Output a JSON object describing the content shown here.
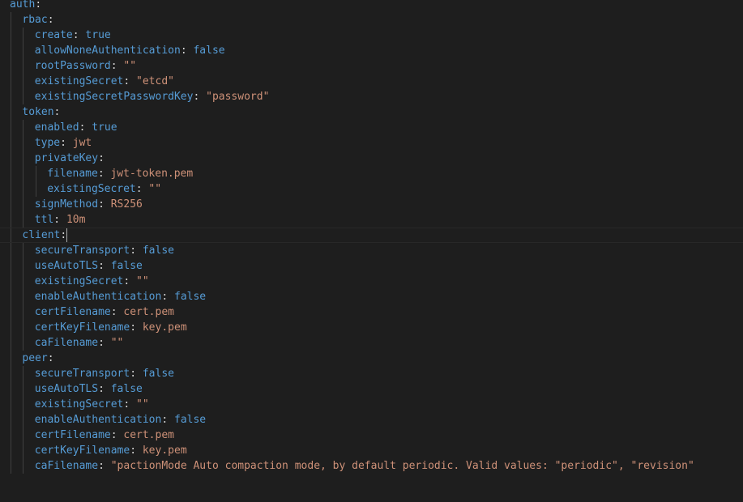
{
  "editor": {
    "language": "yaml",
    "theme": {
      "background": "#1e1e1e",
      "key_color": "#569cd6",
      "string_color": "#ce9178",
      "punctuation_color": "#d4d4d4",
      "indent_guide_color": "#404040",
      "current_line_border": "#282828"
    },
    "cursor": {
      "line_index": 15,
      "after": "client:"
    },
    "lines": [
      {
        "indent": 0,
        "key": "auth",
        "punct": ":",
        "value": "",
        "vtype": ""
      },
      {
        "indent": 1,
        "key": "rbac",
        "punct": ":",
        "value": "",
        "vtype": ""
      },
      {
        "indent": 2,
        "key": "create",
        "punct": ": ",
        "value": "true",
        "vtype": "b"
      },
      {
        "indent": 2,
        "key": "allowNoneAuthentication",
        "punct": ": ",
        "value": "false",
        "vtype": "b"
      },
      {
        "indent": 2,
        "key": "rootPassword",
        "punct": ": ",
        "value": "\"\"",
        "vtype": "s"
      },
      {
        "indent": 2,
        "key": "existingSecret",
        "punct": ": ",
        "value": "\"etcd\"",
        "vtype": "s"
      },
      {
        "indent": 2,
        "key": "existingSecretPasswordKey",
        "punct": ": ",
        "value": "\"password\"",
        "vtype": "s"
      },
      {
        "indent": 1,
        "key": "token",
        "punct": ":",
        "value": "",
        "vtype": ""
      },
      {
        "indent": 2,
        "key": "enabled",
        "punct": ": ",
        "value": "true",
        "vtype": "b"
      },
      {
        "indent": 2,
        "key": "type",
        "punct": ": ",
        "value": "jwt",
        "vtype": "s"
      },
      {
        "indent": 2,
        "key": "privateKey",
        "punct": ":",
        "value": "",
        "vtype": ""
      },
      {
        "indent": 3,
        "key": "filename",
        "punct": ": ",
        "value": "jwt-token.pem",
        "vtype": "s"
      },
      {
        "indent": 3,
        "key": "existingSecret",
        "punct": ": ",
        "value": "\"\"",
        "vtype": "s"
      },
      {
        "indent": 2,
        "key": "signMethod",
        "punct": ": ",
        "value": "RS256",
        "vtype": "s"
      },
      {
        "indent": 2,
        "key": "ttl",
        "punct": ": ",
        "value": "10m",
        "vtype": "s"
      },
      {
        "indent": 1,
        "key": "client",
        "punct": ":",
        "value": "",
        "vtype": ""
      },
      {
        "indent": 2,
        "key": "secureTransport",
        "punct": ": ",
        "value": "false",
        "vtype": "b"
      },
      {
        "indent": 2,
        "key": "useAutoTLS",
        "punct": ": ",
        "value": "false",
        "vtype": "b"
      },
      {
        "indent": 2,
        "key": "existingSecret",
        "punct": ": ",
        "value": "\"\"",
        "vtype": "s"
      },
      {
        "indent": 2,
        "key": "enableAuthentication",
        "punct": ": ",
        "value": "false",
        "vtype": "b"
      },
      {
        "indent": 2,
        "key": "certFilename",
        "punct": ": ",
        "value": "cert.pem",
        "vtype": "s"
      },
      {
        "indent": 2,
        "key": "certKeyFilename",
        "punct": ": ",
        "value": "key.pem",
        "vtype": "s"
      },
      {
        "indent": 2,
        "key": "caFilename",
        "punct": ": ",
        "value": "\"\"",
        "vtype": "s"
      },
      {
        "indent": 1,
        "key": "peer",
        "punct": ":",
        "value": "",
        "vtype": ""
      },
      {
        "indent": 2,
        "key": "secureTransport",
        "punct": ": ",
        "value": "false",
        "vtype": "b"
      },
      {
        "indent": 2,
        "key": "useAutoTLS",
        "punct": ": ",
        "value": "false",
        "vtype": "b"
      },
      {
        "indent": 2,
        "key": "existingSecret",
        "punct": ": ",
        "value": "\"\"",
        "vtype": "s"
      },
      {
        "indent": 2,
        "key": "enableAuthentication",
        "punct": ": ",
        "value": "false",
        "vtype": "b"
      },
      {
        "indent": 2,
        "key": "certFilename",
        "punct": ": ",
        "value": "cert.pem",
        "vtype": "s"
      },
      {
        "indent": 2,
        "key": "certKeyFilename",
        "punct": ": ",
        "value": "key.pem",
        "vtype": "s"
      },
      {
        "indent": 2,
        "key": "caFilename",
        "punct": ": ",
        "value": "\"pactionMode Auto compaction mode, by default periodic. Valid values: \"periodic\", \"revision\"",
        "vtype": "s"
      }
    ]
  }
}
